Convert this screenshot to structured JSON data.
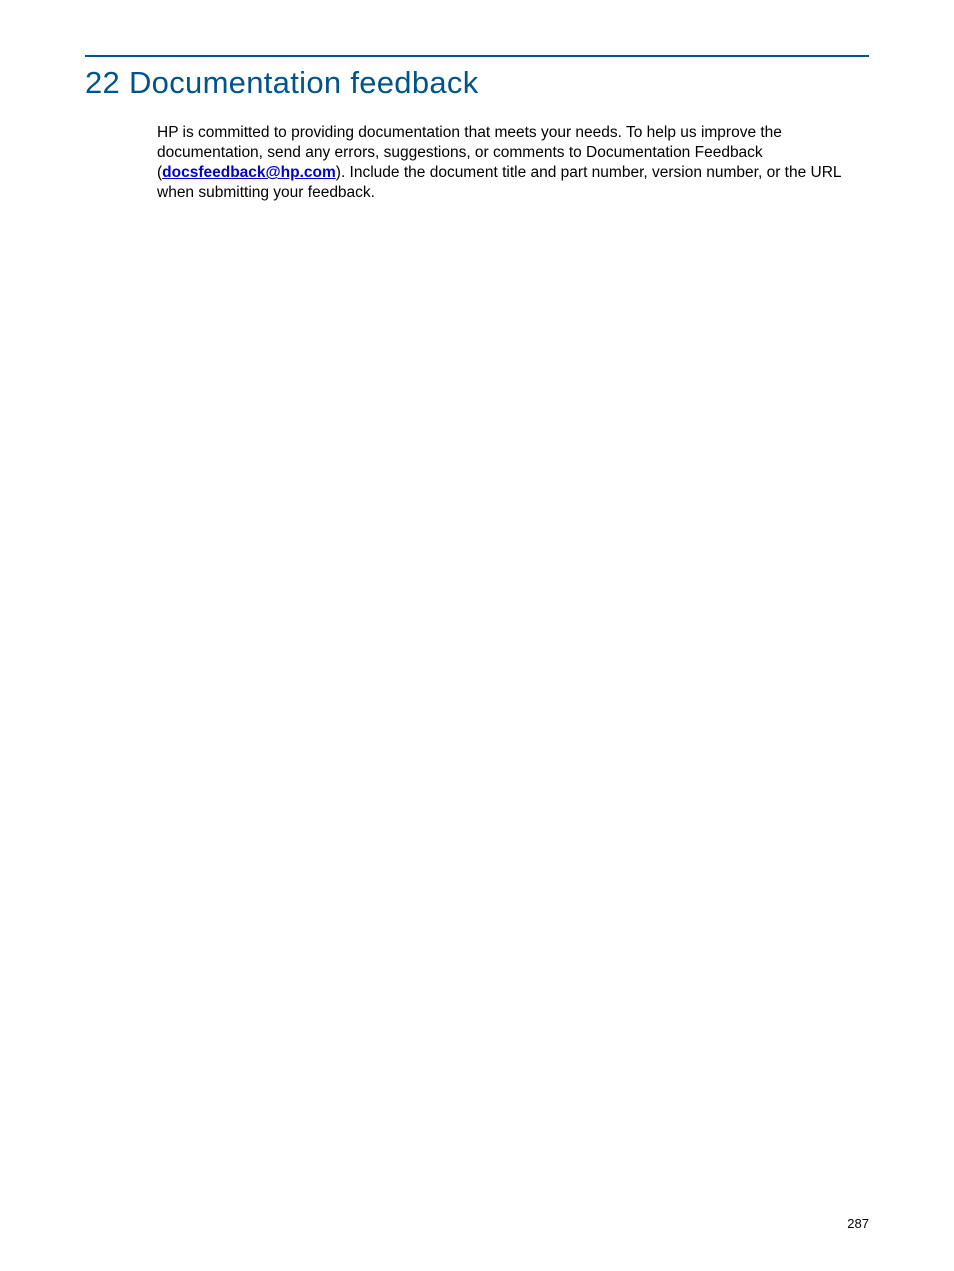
{
  "heading": "22 Documentation feedback",
  "body": {
    "part1": "HP is committed to providing documentation that meets your needs. To help us improve the documentation, send any errors, suggestions, or comments to Documentation Feedback (",
    "email": "docsfeedback@hp.com",
    "part2": "). Include the document title and part number, version number, or the URL when submitting your feedback."
  },
  "page_number": "287"
}
